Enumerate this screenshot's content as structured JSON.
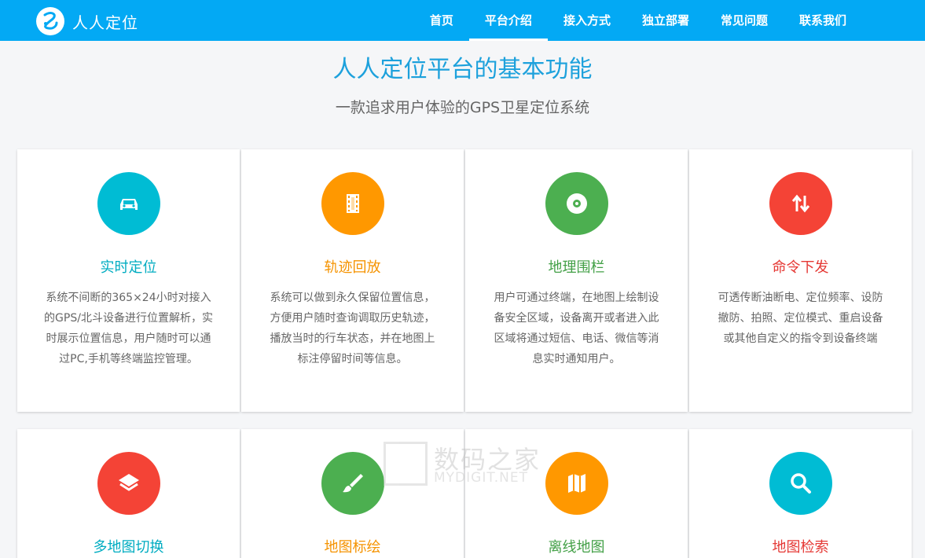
{
  "header": {
    "brand": "人人定位",
    "nav": [
      "首页",
      "平台介绍",
      "接入方式",
      "独立部署",
      "常见问题",
      "联系我们"
    ],
    "active_nav": "平台介绍",
    "bg_color": "#03a9f4"
  },
  "main": {
    "title": "人人定位平台的基本功能",
    "subtitle": "一款追求用户体验的GPS卫星定位系统"
  },
  "features": [
    {
      "title": "实时定位",
      "icon": "car-icon",
      "color": "#00bcd4",
      "desc": "系统不间断的365×24小时对接入的GPS/北斗设备进行位置解析，实时展示位置信息，用户随时可以通过PC,手机等终端监控管理。"
    },
    {
      "title": "轨迹回放",
      "icon": "film-icon",
      "color": "#ff9800",
      "desc": "系统可以做到永久保留位置信息，方便用户随时查询调取历史轨迹，播放当时的行车状态，并在地图上标注停留时间等信息。"
    },
    {
      "title": "地理围栏",
      "icon": "disc-icon",
      "color": "#4caf50",
      "desc": "用户可通过终端，在地图上绘制设备安全区域，设备离开或者进入此区域将通过短信、电话、微信等消息实时通知用户。"
    },
    {
      "title": "命令下发",
      "icon": "swap-vertical-icon",
      "color": "#f44336",
      "desc": "可透传断油断电、定位频率、设防撤防、拍照、定位模式、重启设备或其他自定义的指令到设备终端"
    },
    {
      "title": "多地图切换",
      "icon": "layers-icon",
      "color": "#f44336"
    },
    {
      "title": "地图标绘",
      "icon": "brush-icon",
      "color": "#4caf50"
    },
    {
      "title": "离线地图",
      "icon": "map-icon",
      "color": "#ff9800"
    },
    {
      "title": "地图检索",
      "icon": "search-icon",
      "color": "#00bcd4"
    }
  ],
  "watermark": {
    "cn": "数码之家",
    "en": "MYDIGIT.NET"
  }
}
